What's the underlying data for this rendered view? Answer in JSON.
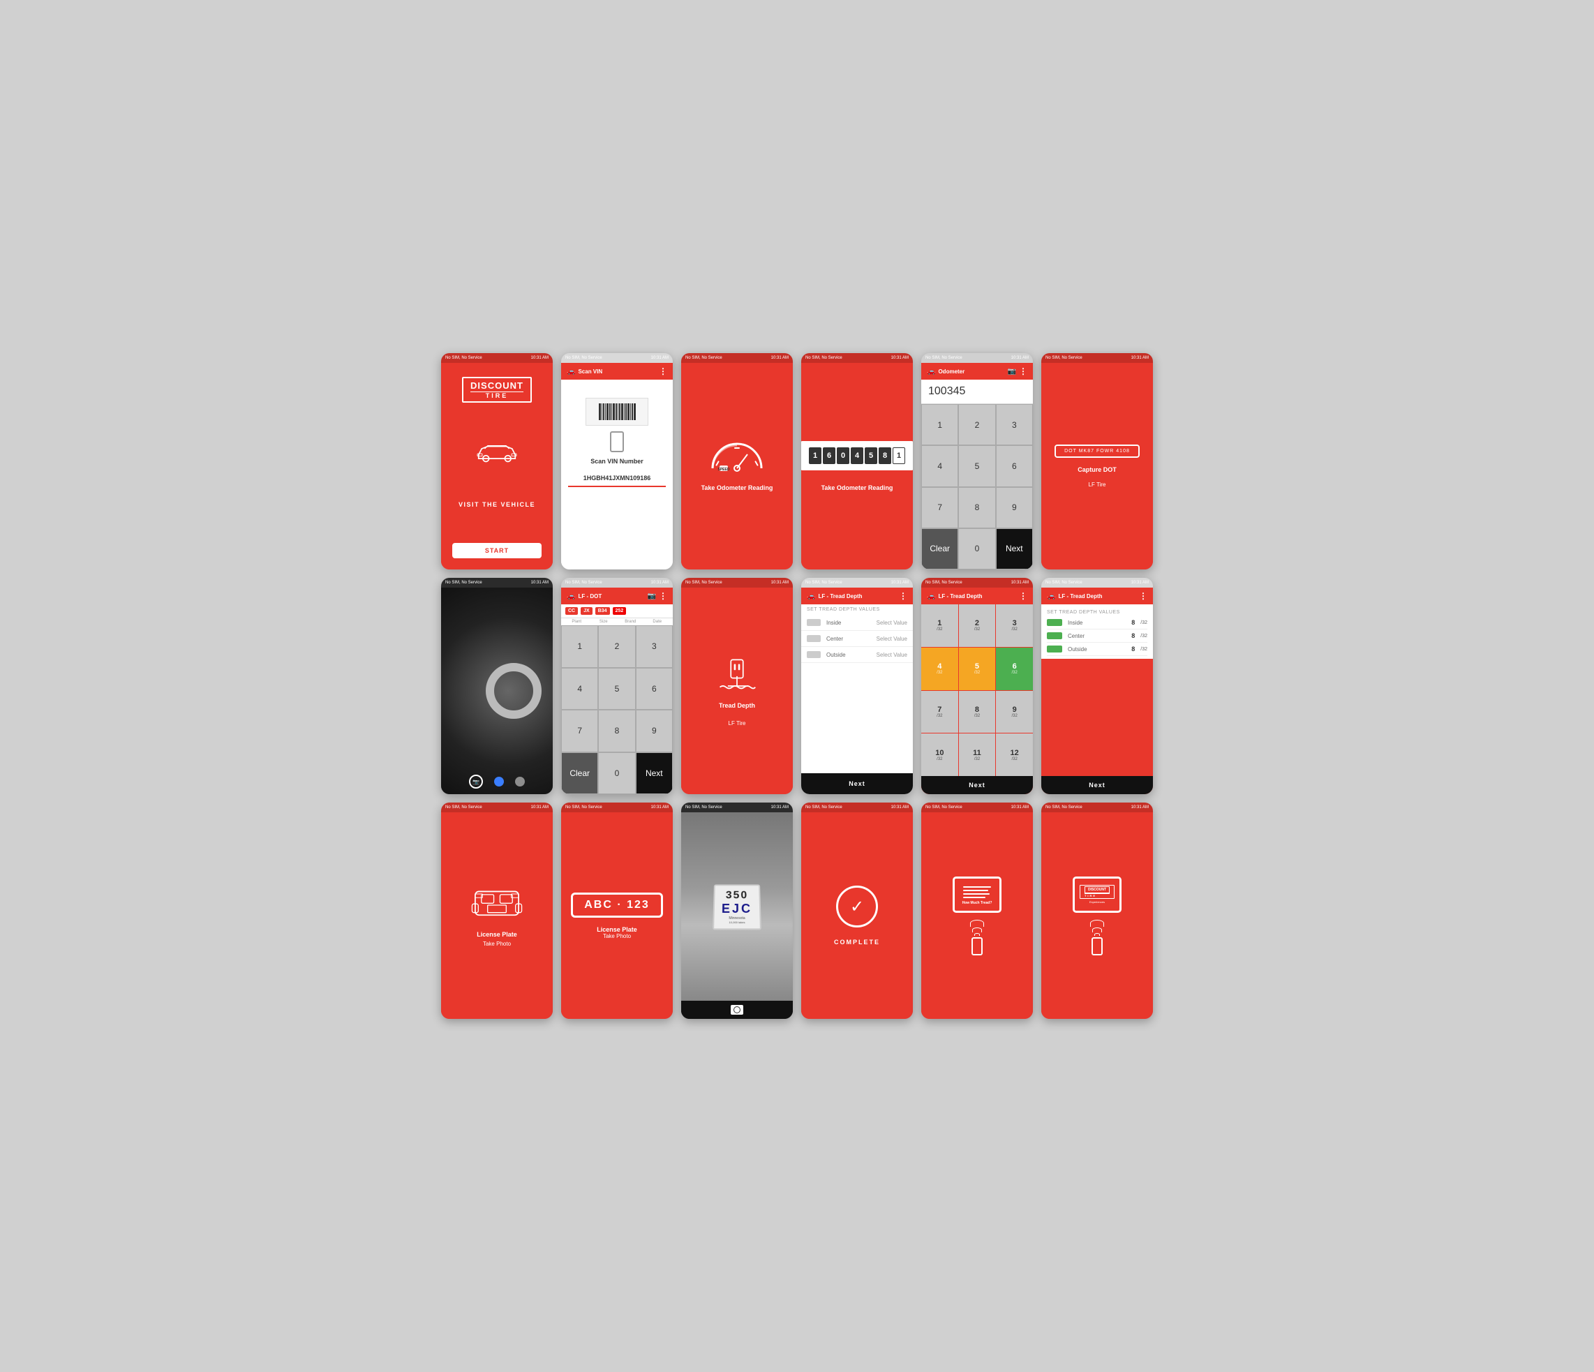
{
  "screens": [
    {
      "id": "visit-vehicle",
      "statusBar": {
        "left": "No SIM, No Service",
        "right": "10:31 AM"
      },
      "header": null,
      "title": "VISIT THE VEHICLE",
      "logo": {
        "line1": "DISCOUNT",
        "line2": "TIRE"
      },
      "button": "START",
      "bg": "red"
    },
    {
      "id": "scan-vin",
      "statusBar": {
        "left": "No SIM, No Service",
        "right": "10:31 AM"
      },
      "header": {
        "title": "Scan VIN",
        "icon": "car-icon"
      },
      "scanLabel": "Scan VIN Number",
      "vinNumber": "1HGBH41JXMN109186",
      "bg": "white"
    },
    {
      "id": "odometer-icon",
      "statusBar": {
        "left": "No SIM, No Service",
        "right": "10:31 AM"
      },
      "header": null,
      "label": "Take Odometer Reading",
      "bg": "red"
    },
    {
      "id": "odometer-display",
      "statusBar": {
        "left": "No SIM, No Service",
        "right": "10:31 AM"
      },
      "header": null,
      "digits": [
        "1",
        "6",
        "0",
        "4",
        "5",
        "8",
        "1"
      ],
      "label": "Take Odometer Reading",
      "bg": "red"
    },
    {
      "id": "odometer-keypad",
      "statusBar": {
        "left": "No SIM, No Service",
        "right": "10:31 AM"
      },
      "header": {
        "title": "Odometer",
        "icon": "car-icon"
      },
      "inputValue": "100345",
      "keys": [
        [
          "1",
          "2",
          "3"
        ],
        [
          "4",
          "5",
          "6"
        ],
        [
          "7",
          "8",
          "9"
        ],
        [
          "Clear",
          "0",
          "Next"
        ]
      ],
      "bg": "gray"
    },
    {
      "id": "dot-capture",
      "statusBar": {
        "left": "No SIM, No Service",
        "right": "10:31 AM"
      },
      "header": null,
      "dotText": "DOT  MK87 FOWR 4108",
      "label": "Capture DOT",
      "subLabel": "LF Tire",
      "bg": "red"
    },
    {
      "id": "tire-photo",
      "statusBar": {
        "left": "No SIM, No Service",
        "right": "10:31 AM"
      },
      "header": null,
      "bg": "photo"
    },
    {
      "id": "dot-keypad",
      "statusBar": {
        "left": "No SIM, No Service",
        "right": "10:31 AM"
      },
      "header": {
        "title": "LF - DOT",
        "icon": "car-icon"
      },
      "dotCells": [
        "CC",
        "JX",
        "B34",
        "252"
      ],
      "dotLabels": [
        "Plant",
        "Size",
        "Brand",
        "Date"
      ],
      "keys": [
        [
          "1",
          "2",
          "3"
        ],
        [
          "4",
          "5",
          "6"
        ],
        [
          "7",
          "8",
          "9"
        ],
        [
          "Clear",
          "0",
          "Next"
        ]
      ],
      "bg": "gray"
    },
    {
      "id": "tread-depth-icon",
      "statusBar": {
        "left": "No SIM, No Service",
        "right": "10:31 AM"
      },
      "header": null,
      "label": "Tread Depth",
      "subLabel": "LF Tire",
      "bg": "red"
    },
    {
      "id": "tread-depth-select",
      "statusBar": {
        "left": "No SIM, No Service",
        "right": "10:31 AM"
      },
      "header": {
        "title": "LF - Tread Depth",
        "icon": "car-icon"
      },
      "sectionTitle": "SET TREAD DEPTH VALUES",
      "rows": [
        {
          "label": "Inside",
          "value": "Select Value"
        },
        {
          "label": "Center",
          "value": "Select Value"
        },
        {
          "label": "Outside",
          "value": "Select Value"
        }
      ],
      "nextLabel": "Next",
      "bg": "white"
    },
    {
      "id": "tread-depth-grid",
      "statusBar": {
        "left": "No SIM, No Service",
        "right": "10:31 AM"
      },
      "header": {
        "title": "LF - Tread Depth",
        "icon": "car-icon"
      },
      "cells": [
        {
          "num": "1",
          "unit": "/32",
          "color": "gray"
        },
        {
          "num": "2",
          "unit": "/32",
          "color": "gray"
        },
        {
          "num": "3",
          "unit": "/32",
          "color": "gray"
        },
        {
          "num": "4",
          "unit": "/32",
          "color": "orange"
        },
        {
          "num": "5",
          "unit": "/32",
          "color": "orange"
        },
        {
          "num": "6",
          "unit": "/32",
          "color": "green"
        },
        {
          "num": "7",
          "unit": "/32",
          "color": "gray"
        },
        {
          "num": "8",
          "unit": "/32",
          "color": "gray"
        },
        {
          "num": "9",
          "unit": "/32",
          "color": "gray"
        },
        {
          "num": "10",
          "unit": "/32",
          "color": "gray"
        },
        {
          "num": "11",
          "unit": "/32",
          "color": "gray"
        },
        {
          "num": "12",
          "unit": "/32",
          "color": "gray"
        }
      ],
      "nextLabel": "Next",
      "bg": "red"
    },
    {
      "id": "tread-depth-green",
      "statusBar": {
        "left": "No SIM, No Service",
        "right": "10:31 AM"
      },
      "header": {
        "title": "LF - Tread Depth",
        "icon": "car-icon"
      },
      "sectionTitle": "SET TREAD DEPTH VALUES",
      "rows": [
        {
          "label": "Inside",
          "value": "8",
          "unit": "/32"
        },
        {
          "label": "Center",
          "value": "8",
          "unit": "/32"
        },
        {
          "label": "Outside",
          "value": "8",
          "unit": "/32"
        }
      ],
      "nextLabel": "Next",
      "bg": "white"
    },
    {
      "id": "license-plate-icon",
      "statusBar": {
        "left": "No SIM, No Service",
        "right": "10:31 AM"
      },
      "header": null,
      "label": "License Plate",
      "subLabel": "Take Photo",
      "bg": "red"
    },
    {
      "id": "license-plate-text",
      "statusBar": {
        "left": "No SIM, No Service",
        "right": "10:31 AM"
      },
      "header": null,
      "plateText": "ABC · 123",
      "label": "License Plate",
      "subLabel": "Take Photo",
      "bg": "red"
    },
    {
      "id": "license-plate-camera",
      "statusBar": {
        "left": "No SIM, No Service",
        "right": "10:31 AM"
      },
      "header": null,
      "plateNumber": "350",
      "plateLine2": "EJC",
      "plateState": "Minnesota",
      "bg": "photo"
    },
    {
      "id": "complete",
      "statusBar": {
        "left": "No SIM, No Service",
        "right": "10:31 AM"
      },
      "header": null,
      "label": "COMPLETE",
      "bg": "red"
    },
    {
      "id": "how-much-tread",
      "statusBar": {
        "left": "No SIM, No Service",
        "right": "10:31 AM"
      },
      "header": null,
      "tabletLabel": "How Much Tread?",
      "bg": "red"
    },
    {
      "id": "experiences",
      "statusBar": {
        "left": "No SIM, No Service",
        "right": "10:31 AM"
      },
      "header": null,
      "logo1": "DISCOUNT",
      "logo2": "TIRE",
      "tabletLabel": "Experiences",
      "bg": "red"
    }
  ]
}
